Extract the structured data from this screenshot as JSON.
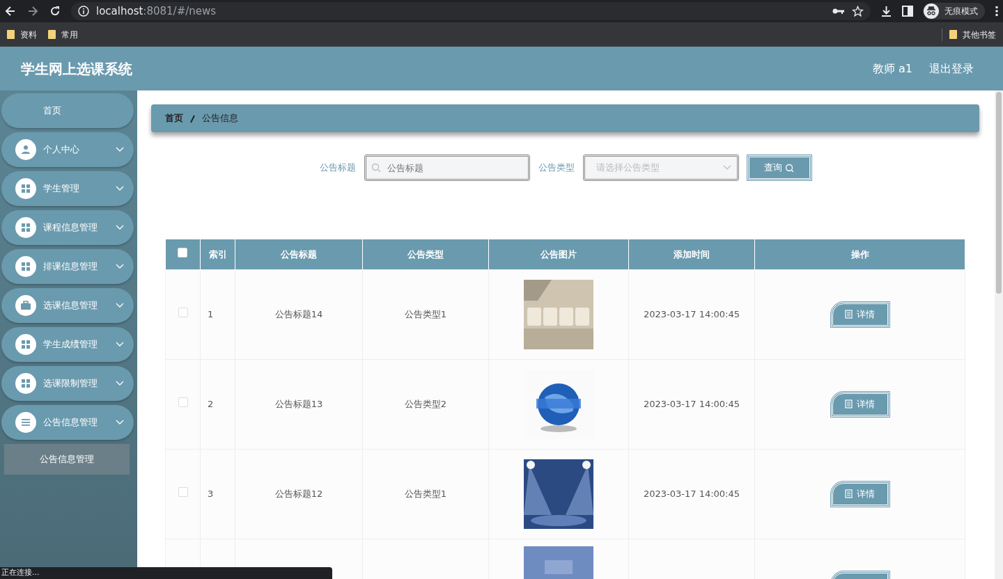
{
  "browser": {
    "url_host": "localhost",
    "url_rest": ":8081/#/news",
    "profile": "无痕模式",
    "bookmarks": [
      "资料",
      "常用"
    ],
    "other_bookmarks": "其他书签"
  },
  "header": {
    "title": "学生网上选课系统",
    "user": "教师 a1",
    "logout": "退出登录"
  },
  "sidebar": {
    "items": [
      {
        "label": "首页",
        "kind": "plain"
      },
      {
        "label": "个人中心",
        "kind": "user"
      },
      {
        "label": "学生管理",
        "kind": "grid"
      },
      {
        "label": "课程信息管理",
        "kind": "grid"
      },
      {
        "label": "排课信息管理",
        "kind": "grid"
      },
      {
        "label": "选课信息管理",
        "kind": "case"
      },
      {
        "label": "学生成绩管理",
        "kind": "grid"
      },
      {
        "label": "选课限制管理",
        "kind": "grid"
      },
      {
        "label": "公告信息管理",
        "kind": "list",
        "expanded": true,
        "children": [
          {
            "label": "公告信息管理"
          }
        ]
      }
    ]
  },
  "breadcrumb": [
    "首页",
    "公告信息"
  ],
  "search": {
    "title_label": "公告标题",
    "title_placeholder": "公告标题",
    "type_label": "公告类型",
    "type_placeholder": "请选择公告类型",
    "button": "查询"
  },
  "table": {
    "select_all": {
      "checked": false
    },
    "columns": [
      "索引",
      "公告标题",
      "公告类型",
      "公告图片",
      "添加时间",
      "操作"
    ],
    "rows": [
      {
        "checked": false,
        "index": "1",
        "title": "公告标题14",
        "type": "公告类型1",
        "time": "2023-03-17 14:00:45",
        "action": "详情"
      },
      {
        "checked": false,
        "index": "2",
        "title": "公告标题13",
        "type": "公告类型2",
        "time": "2023-03-17 14:00:45",
        "action": "详情"
      },
      {
        "checked": false,
        "index": "3",
        "title": "公告标题12",
        "type": "公告类型1",
        "time": "2023-03-17 14:00:45",
        "action": "详情"
      },
      {
        "kind": "cut"
      }
    ]
  },
  "status_bar": "正在连接..."
}
